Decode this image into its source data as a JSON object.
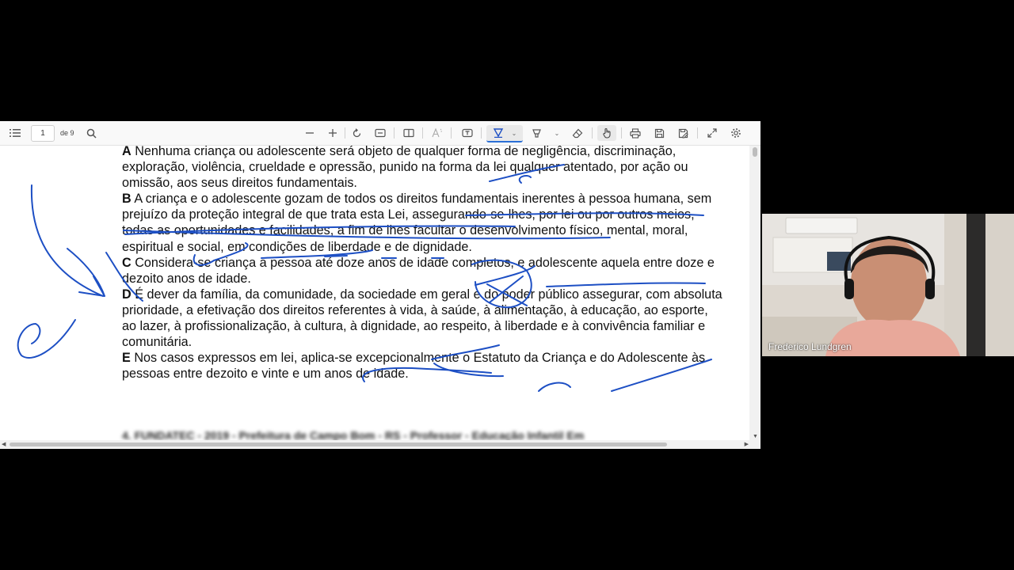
{
  "toolbar": {
    "page_current": "1",
    "page_total_label": "de 9"
  },
  "document": {
    "options": [
      {
        "letter": "A",
        "text": "Nenhuma criança ou adolescente será objeto de qualquer forma de negligência, discriminação, exploração, violência, crueldade e opressão, punido na forma da lei qualquer atentado, por ação ou omissão, aos seus direitos fundamentais."
      },
      {
        "letter": "B",
        "text": "A criança e o adolescente gozam de todos os direitos fundamentais inerentes à pessoa humana, sem prejuízo da proteção integral de que trata esta Lei, assegurando-se-lhes, por lei ou por outros meios, todas as oportunidades e facilidades, a fim de lhes facultar o desenvolvimento físico, mental, moral, espiritual e social, em condições de liberdade e de dignidade."
      },
      {
        "letter": "C",
        "text": "Considera-se criança a pessoa até doze anos de idade completos, e adolescente aquela entre doze e dezoito anos de idade."
      },
      {
        "letter": "D",
        "text": "É dever da família, da comunidade, da sociedade em geral e do poder público assegurar, com absoluta prioridade, a efetivação dos direitos referentes à vida, à saúde, à alimentação, à educação, ao esporte, ao lazer, à profissionalização, à cultura, à dignidade, ao respeito, à liberdade e à convivência familiar e comunitária."
      },
      {
        "letter": "E",
        "text": "Nos casos expressos em lei, aplica-se excepcionalmente o Estatuto da Criança e do Adolescente às pessoas entre dezoito e vinte e um anos de idade."
      }
    ],
    "next_question_blurred": "4. FUNDATEC - 2019 - Prefeitura de Campo Bom - RS - Professor - Educação Infantil Em"
  },
  "webcam": {
    "participant_name": "Frederico Lundgren"
  },
  "colors": {
    "ink": "#1d4fc4",
    "toolbar_bg": "#f9f9f9",
    "accent": "#2a6fd6"
  }
}
